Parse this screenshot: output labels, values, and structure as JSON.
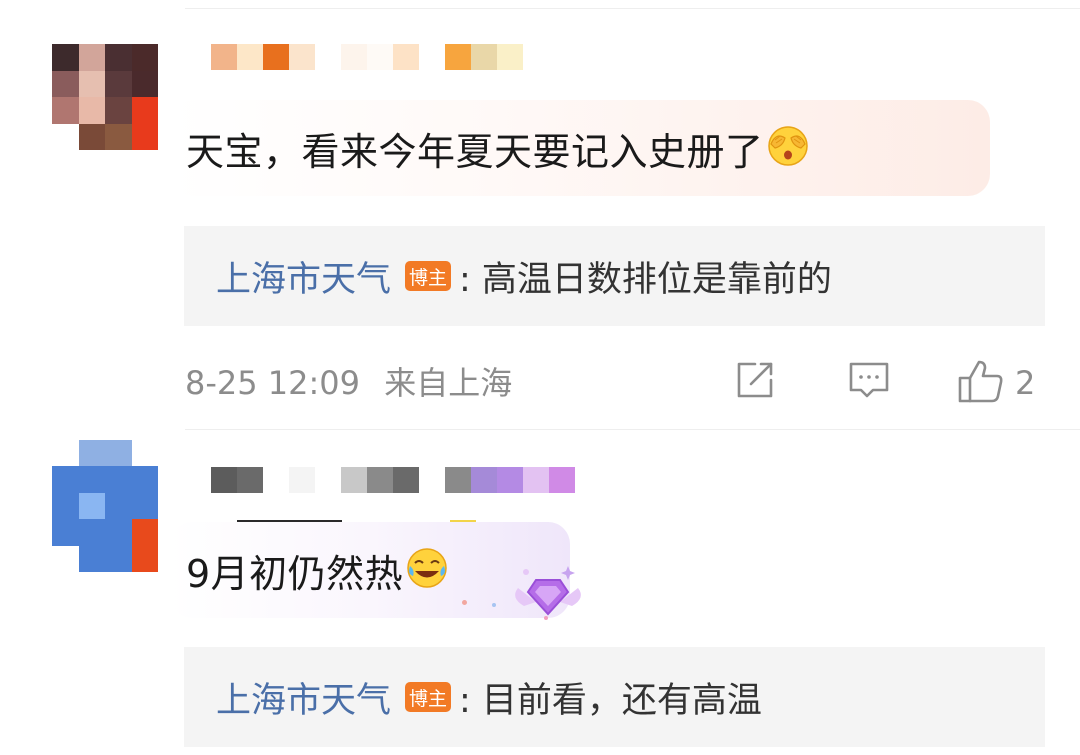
{
  "comments": [
    {
      "text": "天宝，看来今年夏天要记入史册了",
      "emoji": "covering-eyes-emoji",
      "reply": {
        "author": "上海市天气",
        "badge": "博主",
        "text": ": 高温日数排位是靠前的"
      },
      "meta": {
        "date_time": "8-25 12:09",
        "location": "来自上海"
      },
      "actions": {
        "share_icon": "share-icon",
        "comment_icon": "comment-icon",
        "like_icon": "thumbs-up-icon",
        "like_count": "2"
      }
    },
    {
      "text": "9月初仍然热",
      "emoji": "tears-of-joy-emoji",
      "reply": {
        "author": "上海市天气",
        "badge": "博主",
        "text": ": 目前看，还有高温"
      }
    }
  ],
  "colors": {
    "link": "#4a6fa8",
    "badge": "#f27a25",
    "reply_bg": "#f4f4f4",
    "meta": "#8c8c8c"
  }
}
